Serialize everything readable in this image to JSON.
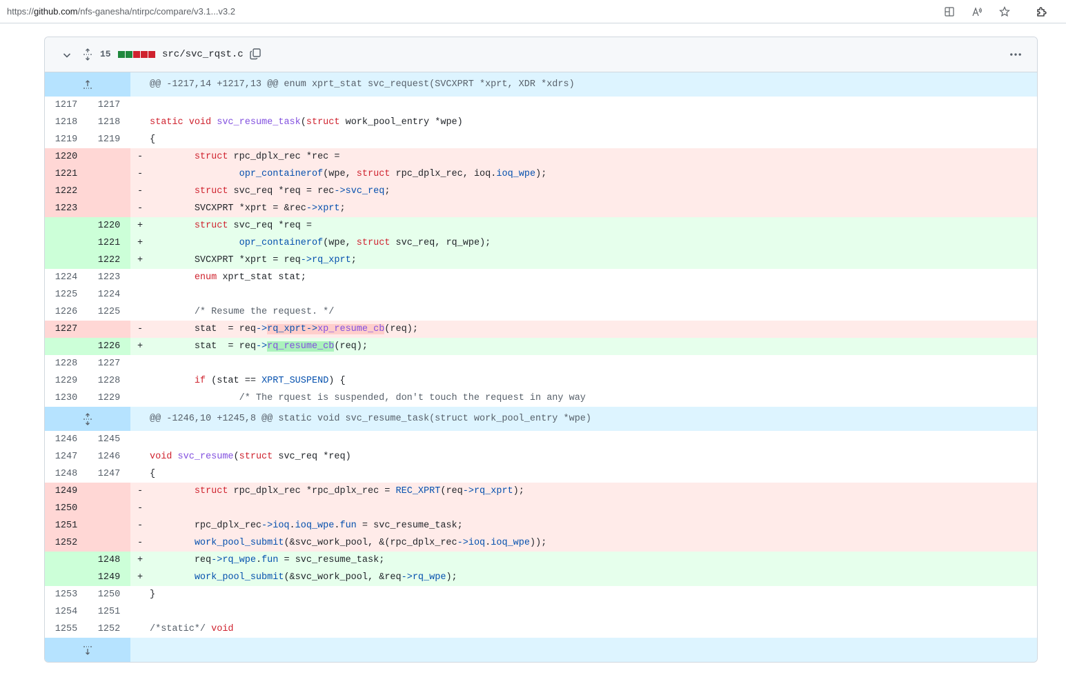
{
  "browser": {
    "url_prefix": "https://",
    "url_host": "github.com",
    "url_path": "/nfs-ganesha/ntirpc/compare/v3.1...v3.2",
    "icons": [
      "split-screen-icon",
      "read-aloud-icon",
      "favorite-star-icon",
      "extensions-icon"
    ]
  },
  "file": {
    "changes_count": "15",
    "diffstat": [
      "add",
      "add",
      "del",
      "del",
      "del"
    ],
    "path": "src/svc_rqst.c"
  },
  "hunks": [
    {
      "header": "@@ -1217,14 +1217,13 @@ enum xprt_stat svc_request(SVCXPRT *xprt, XDR *xdrs)",
      "lines": [
        {
          "t": "ctx",
          "o": "1217",
          "n": "1217",
          "s": " ",
          "c": ""
        },
        {
          "t": "ctx",
          "o": "1218",
          "n": "1218",
          "s": " ",
          "c": "static void svc_resume_task(struct work_pool_entry *wpe)"
        },
        {
          "t": "ctx",
          "o": "1219",
          "n": "1219",
          "s": " ",
          "c": "{"
        },
        {
          "t": "del",
          "o": "1220",
          "n": "",
          "s": "-",
          "c": "\tstruct rpc_dplx_rec *rec ="
        },
        {
          "t": "del",
          "o": "1221",
          "n": "",
          "s": "-",
          "c": "\t\topr_containerof(wpe, struct rpc_dplx_rec, ioq.ioq_wpe);"
        },
        {
          "t": "del",
          "o": "1222",
          "n": "",
          "s": "-",
          "c": "\tstruct svc_req *req = rec->svc_req;"
        },
        {
          "t": "del",
          "o": "1223",
          "n": "",
          "s": "-",
          "c": "\tSVCXPRT *xprt = &rec->xprt;"
        },
        {
          "t": "add",
          "o": "",
          "n": "1220",
          "s": "+",
          "c": "\tstruct svc_req *req ="
        },
        {
          "t": "add",
          "o": "",
          "n": "1221",
          "s": "+",
          "c": "\t\topr_containerof(wpe, struct svc_req, rq_wpe);"
        },
        {
          "t": "add",
          "o": "",
          "n": "1222",
          "s": "+",
          "c": "\tSVCXPRT *xprt = req->rq_xprt;"
        },
        {
          "t": "ctx",
          "o": "1224",
          "n": "1223",
          "s": " ",
          "c": "\tenum xprt_stat stat;"
        },
        {
          "t": "ctx",
          "o": "1225",
          "n": "1224",
          "s": " ",
          "c": ""
        },
        {
          "t": "ctx",
          "o": "1226",
          "n": "1225",
          "s": " ",
          "c": "\t/* Resume the request. */"
        },
        {
          "t": "del",
          "o": "1227",
          "n": "",
          "s": "-",
          "c": "\tstat  = req->rq_xprt->xp_resume_cb(req);"
        },
        {
          "t": "add",
          "o": "",
          "n": "1226",
          "s": "+",
          "c": "\tstat  = req->rq_resume_cb(req);"
        },
        {
          "t": "ctx",
          "o": "1228",
          "n": "1227",
          "s": " ",
          "c": ""
        },
        {
          "t": "ctx",
          "o": "1229",
          "n": "1228",
          "s": " ",
          "c": "\tif (stat == XPRT_SUSPEND) {"
        },
        {
          "t": "ctx",
          "o": "1230",
          "n": "1229",
          "s": " ",
          "c": "\t\t/* The rquest is suspended, don't touch the request in any way"
        }
      ]
    },
    {
      "header": "@@ -1246,10 +1245,8 @@ static void svc_resume_task(struct work_pool_entry *wpe)",
      "lines": [
        {
          "t": "ctx",
          "o": "1246",
          "n": "1245",
          "s": " ",
          "c": ""
        },
        {
          "t": "ctx",
          "o": "1247",
          "n": "1246",
          "s": " ",
          "c": "void svc_resume(struct svc_req *req)"
        },
        {
          "t": "ctx",
          "o": "1248",
          "n": "1247",
          "s": " ",
          "c": "{"
        },
        {
          "t": "del",
          "o": "1249",
          "n": "",
          "s": "-",
          "c": "\tstruct rpc_dplx_rec *rpc_dplx_rec = REC_XPRT(req->rq_xprt);"
        },
        {
          "t": "del",
          "o": "1250",
          "n": "",
          "s": "-",
          "c": ""
        },
        {
          "t": "del",
          "o": "1251",
          "n": "",
          "s": "-",
          "c": "\trpc_dplx_rec->ioq.ioq_wpe.fun = svc_resume_task;"
        },
        {
          "t": "del",
          "o": "1252",
          "n": "",
          "s": "-",
          "c": "\twork_pool_submit(&svc_work_pool, &(rpc_dplx_rec->ioq.ioq_wpe));"
        },
        {
          "t": "add",
          "o": "",
          "n": "1248",
          "s": "+",
          "c": "\treq->rq_wpe.fun = svc_resume_task;"
        },
        {
          "t": "add",
          "o": "",
          "n": "1249",
          "s": "+",
          "c": "\twork_pool_submit(&svc_work_pool, &req->rq_wpe);"
        },
        {
          "t": "ctx",
          "o": "1253",
          "n": "1250",
          "s": " ",
          "c": "}"
        },
        {
          "t": "ctx",
          "o": "1254",
          "n": "1251",
          "s": " ",
          "c": ""
        },
        {
          "t": "ctx",
          "o": "1255",
          "n": "1252",
          "s": " ",
          "c": "/*static*/ void"
        }
      ]
    }
  ],
  "colors": {
    "hunk_bg": "#ddf4ff",
    "hunk_gutter": "#b6e3ff",
    "del_bg": "#ffebe9",
    "del_num_bg": "#ffd7d5",
    "add_bg": "#e6ffec",
    "add_num_bg": "#ccffd8",
    "keyword": "#cf222e",
    "function": "#8250df",
    "member": "#0550ae"
  }
}
